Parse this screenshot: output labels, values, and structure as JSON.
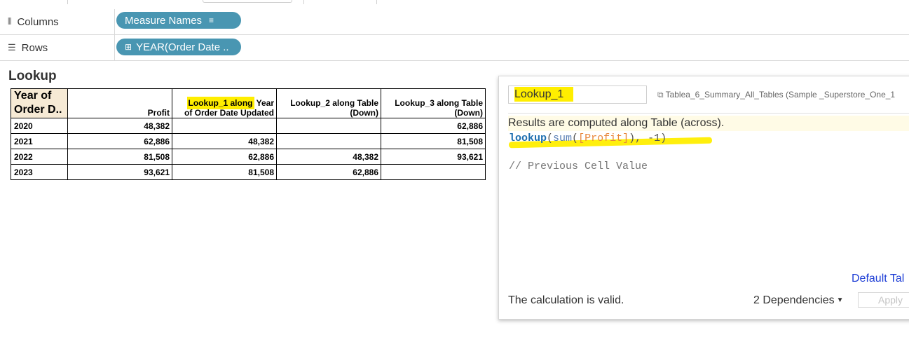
{
  "shelves": {
    "columns": {
      "label": "Columns",
      "icon": "columns-icon",
      "pill": "Measure Names"
    },
    "rows": {
      "label": "Rows",
      "icon": "rows-icon",
      "pill": "YEAR(Order Date .."
    }
  },
  "view": {
    "title": "Lookup",
    "table": {
      "row_header": "Year of Order D..",
      "columns": [
        "Profit",
        "Lookup_1 along Year of Order Date Updated",
        "Lookup_2 along Table (Down)",
        "Lookup_3 along Table (Down)"
      ],
      "column_header_parts": {
        "lookup1_line1_hl": "Lookup_1 along",
        "lookup1_line1_rest": " Year",
        "lookup1_line2": "of Order Date Updated",
        "lookup2_line1": "Lookup_2 along Table",
        "lookup2_line2": "(Down)",
        "lookup3_line1": "Lookup_3 along Table",
        "lookup3_line2": "(Down)"
      },
      "rows": [
        {
          "year": "2020",
          "profit": "48,382",
          "lookup1": "",
          "lookup2": "",
          "lookup3": "62,886"
        },
        {
          "year": "2021",
          "profit": "62,886",
          "lookup1": "48,382",
          "lookup2": "",
          "lookup3": "81,508"
        },
        {
          "year": "2022",
          "profit": "81,508",
          "lookup1": "62,886",
          "lookup2": "48,382",
          "lookup3": "93,621"
        },
        {
          "year": "2023",
          "profit": "93,621",
          "lookup1": "81,508",
          "lookup2": "62,886",
          "lookup3": ""
        }
      ]
    }
  },
  "calc_editor": {
    "name": "Lookup_1",
    "datasource": "Tablea_6_Summary_All_Tables (Sample _Superstore_One_1",
    "note": "Results are computed along Table (across).",
    "code": {
      "fn": "lookup",
      "open": "(",
      "fn2": "sum",
      "open2": "(",
      "field": "[Profit]",
      "close": "))",
      "rest": ", -1)"
    },
    "comment": "// Previous Cell Value",
    "link": "Default Tal",
    "status": "The calculation is valid.",
    "dependencies": "2 Dependencies",
    "apply": "Apply"
  },
  "colors": {
    "pill": "#4996b2",
    "highlight": "#ffee00",
    "row_header_bg": "#f6ead5"
  }
}
